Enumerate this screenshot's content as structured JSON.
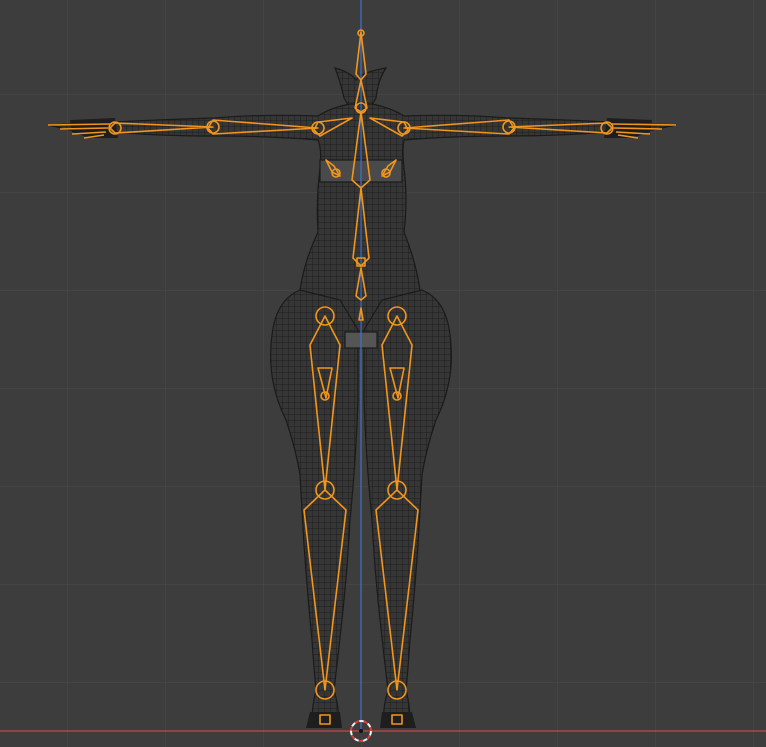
{
  "viewport": {
    "view": "front-orthographic",
    "colors": {
      "background": "#3d3d3d",
      "grid_line": "#4a4a4a",
      "x_axis": "#c24a4a",
      "z_axis": "#3e6fc4",
      "mesh_wire": "#1c1c1c",
      "mesh_fill": "#2e2e2e",
      "armature": "#f0951f",
      "cursor_red": "#e23b3b",
      "cursor_white": "#f2f2f2"
    },
    "objects": {
      "mesh": "female-body-mesh",
      "armature": "rig-armature",
      "cursor": "3d-cursor"
    }
  }
}
